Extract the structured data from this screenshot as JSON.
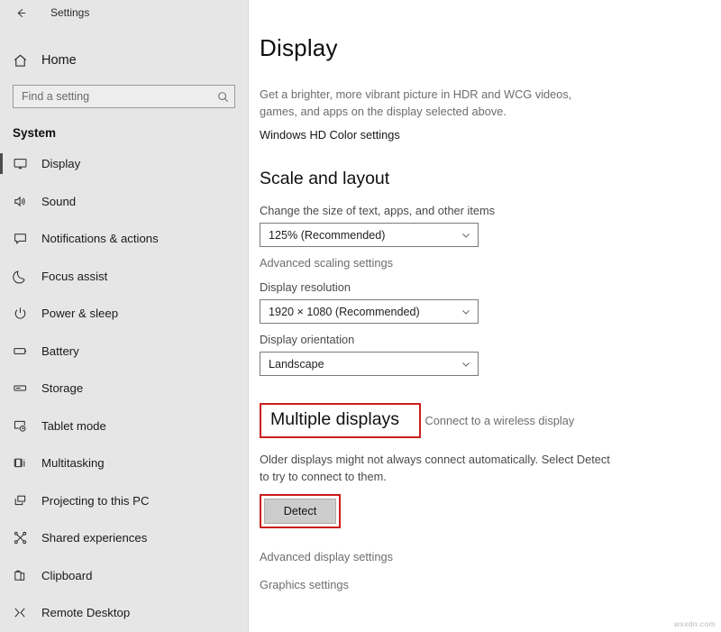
{
  "window": {
    "back_icon": "back-arrow-icon",
    "title": "Settings"
  },
  "sidebar": {
    "home": {
      "label": "Home",
      "icon": "home-icon"
    },
    "search": {
      "value": "",
      "placeholder": "Find a setting",
      "icon": "search-icon"
    },
    "group_title": "System",
    "items": [
      {
        "label": "Display",
        "icon": "monitor-icon",
        "selected": true
      },
      {
        "label": "Sound",
        "icon": "speaker-icon",
        "selected": false
      },
      {
        "label": "Notifications & actions",
        "icon": "notification-icon",
        "selected": false
      },
      {
        "label": "Focus assist",
        "icon": "moon-icon",
        "selected": false
      },
      {
        "label": "Power & sleep",
        "icon": "power-icon",
        "selected": false
      },
      {
        "label": "Battery",
        "icon": "battery-icon",
        "selected": false
      },
      {
        "label": "Storage",
        "icon": "storage-icon",
        "selected": false
      },
      {
        "label": "Tablet mode",
        "icon": "tablet-icon",
        "selected": false
      },
      {
        "label": "Multitasking",
        "icon": "multitasking-icon",
        "selected": false
      },
      {
        "label": "Projecting to this PC",
        "icon": "projecting-icon",
        "selected": false
      },
      {
        "label": "Shared experiences",
        "icon": "share-icon",
        "selected": false
      },
      {
        "label": "Clipboard",
        "icon": "clipboard-icon",
        "selected": false
      },
      {
        "label": "Remote Desktop",
        "icon": "remote-desktop-icon",
        "selected": false
      }
    ]
  },
  "main": {
    "page_title": "Display",
    "hdr_description": "Get a brighter, more vibrant picture in HDR and WCG videos, games, and apps on the display selected above.",
    "hd_color_link": "Windows HD Color settings",
    "scale_section": {
      "heading": "Scale and layout",
      "scale_label": "Change the size of text, apps, and other items",
      "scale_value": "125% (Recommended)",
      "advanced_scaling_link": "Advanced scaling settings",
      "resolution_label": "Display resolution",
      "resolution_value": "1920 × 1080 (Recommended)",
      "orientation_label": "Display orientation",
      "orientation_value": "Landscape"
    },
    "multiple_displays": {
      "heading": "Multiple displays",
      "wireless_link": "Connect to a wireless display",
      "detect_description": "Older displays might not always connect automatically. Select Detect to try to connect to them.",
      "detect_button": "Detect"
    },
    "advanced_display_link": "Advanced display settings",
    "graphics_settings_link": "Graphics settings"
  },
  "annotations": {
    "highlight_color": "#cc1d1d"
  },
  "watermark": "wsxdn.com"
}
